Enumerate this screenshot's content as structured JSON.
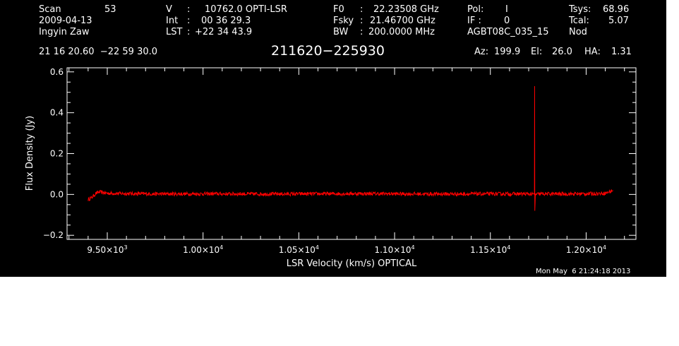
{
  "header": {
    "col1": {
      "scan_label": "Scan",
      "scan_value": "53",
      "date": "2009-04-13",
      "observer": "Ingyin Zaw"
    },
    "col2": {
      "v_label": "V",
      "v_value": "10762.0 OPTI-LSR",
      "int_label": "Int",
      "int_value": "00 36 29.3",
      "lst_label": "LST",
      "lst_value": "+22 34 43.9"
    },
    "col3": {
      "f0_label": "F0",
      "f0_value": "22.23508 GHz",
      "fsky_label": "Fsky",
      "fsky_value": "21.46700 GHz",
      "bw_label": "BW",
      "bw_value": "200.0000 MHz"
    },
    "col4": {
      "pol_label": "Pol:",
      "pol_value": "I",
      "if_label": "IF :",
      "if_value": "0",
      "project": "AGBT08C_035_15"
    },
    "col5": {
      "tsys_label": "Tsys:",
      "tsys_value": "68.96",
      "tcal_label": "Tcal:",
      "tcal_value": "5.07",
      "mode": "Nod"
    },
    "coords": "21 16 20.60  −22 59 30.0",
    "source": "211620−225930",
    "az_label": "Az:",
    "az_value": "199.9",
    "el_label": "El:",
    "el_value": "26.0",
    "ha_label": "HA:",
    "ha_value": "1.31"
  },
  "footer_timestamp": "Mon May  6 21:24:18 2013",
  "colors": {
    "background": "#000000",
    "foreground": "#ffffff",
    "trace": "#ff0000"
  },
  "chart_data": {
    "type": "line",
    "xlabel": "LSR Velocity (km/s) OPTICAL",
    "ylabel": "Flux Density (Jy)",
    "xlim": [
      9290,
      12260
    ],
    "ylim": [
      -0.22,
      0.62
    ],
    "xticks": [
      {
        "value": 9500,
        "mantissa": "9.50",
        "exp": "3"
      },
      {
        "value": 10000,
        "mantissa": "1.00",
        "exp": "4"
      },
      {
        "value": 10500,
        "mantissa": "1.05",
        "exp": "4"
      },
      {
        "value": 11000,
        "mantissa": "1.10",
        "exp": "4"
      },
      {
        "value": 11500,
        "mantissa": "1.15",
        "exp": "4"
      },
      {
        "value": 12000,
        "mantissa": "1.20",
        "exp": "4"
      }
    ],
    "yticks": [
      {
        "value": 0.6,
        "label": "0.6"
      },
      {
        "value": 0.4,
        "label": "0.4"
      },
      {
        "value": 0.2,
        "label": "0.2"
      },
      {
        "value": 0.0,
        "label": "0.0"
      },
      {
        "value": -0.2,
        "label": "−0.2"
      }
    ],
    "grid": false,
    "legend": "none",
    "series": [
      {
        "x": [
          9400,
          9420,
          9440,
          9460,
          9500,
          9600,
          9800,
          10000,
          10400,
          10800,
          11200,
          11600,
          11700,
          11730,
          11731,
          11732,
          11735,
          11760,
          11900,
          12050,
          12100,
          12120,
          12140
        ],
        "y": [
          -0.025,
          -0.015,
          0.005,
          0.012,
          0.006,
          0.004,
          0.002,
          0.003,
          0.002,
          0.004,
          0.002,
          0.003,
          0.002,
          0.0,
          0.53,
          -0.08,
          0.0,
          0.003,
          0.002,
          0.004,
          0.006,
          0.012,
          0.02
        ]
      }
    ]
  }
}
